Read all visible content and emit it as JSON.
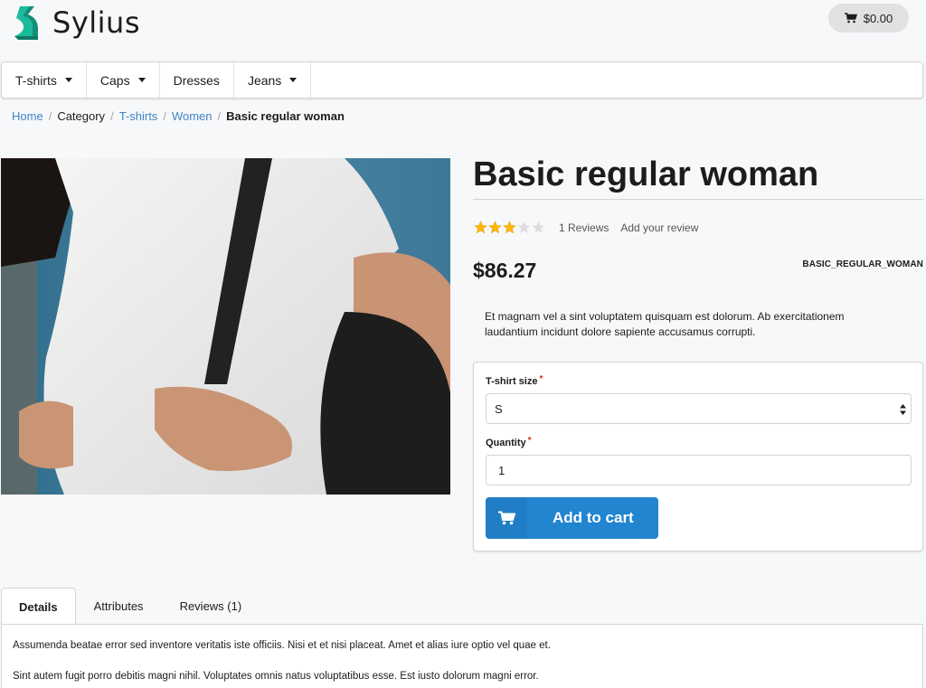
{
  "header": {
    "logo_text": "Sylius",
    "cart_total": "$0.00"
  },
  "menu": {
    "items": [
      {
        "label": "T-shirts",
        "has_caret": true
      },
      {
        "label": "Caps",
        "has_caret": true
      },
      {
        "label": "Dresses",
        "has_caret": false
      },
      {
        "label": "Jeans",
        "has_caret": true
      }
    ]
  },
  "breadcrumb": {
    "home": "Home",
    "sep": "/",
    "category": "Category",
    "tshirts": "T-shirts",
    "women": "Women",
    "current": "Basic regular woman"
  },
  "product": {
    "title": "Basic regular woman",
    "rating": 3,
    "rating_max": 5,
    "reviews_count_label": "1 Reviews",
    "add_review_label": "Add your review",
    "price": "$86.27",
    "sku": "BASIC_REGULAR_WOMAN",
    "description": "Et magnam vel a sint voluptatem quisquam est dolorum. Ab exercitationem laudantium incidunt dolore sapiente accusamus corrupti."
  },
  "form": {
    "size_label": "T-shirt size",
    "size_value": "S",
    "quantity_label": "Quantity",
    "quantity_value": "1",
    "required_mark": "*",
    "add_to_cart_label": "Add to cart"
  },
  "tabs": {
    "details": "Details",
    "attributes": "Attributes",
    "reviews": "Reviews (1)",
    "details_p1": "Assumenda beatae error sed inventore veritatis iste officiis. Nisi et et nisi placeat. Amet et alias iure optio vel quae et.",
    "details_p2": "Sint autem fugit porro debitis magni nihil. Voluptates omnis natus voluptatibus esse. Est iusto dolorum magni error."
  },
  "colors": {
    "brand_teal": "#1abb9c",
    "primary_blue": "#2185d0",
    "link_blue": "#4183c4",
    "star_gold": "#ffb70a",
    "star_empty": "#d4d4d5",
    "required_red": "#db2828"
  },
  "icons": {
    "logo": "sylius-swan-logo",
    "cart": "shopping-cart-icon",
    "select": "select-arrows-icon",
    "star": "star-icon"
  }
}
